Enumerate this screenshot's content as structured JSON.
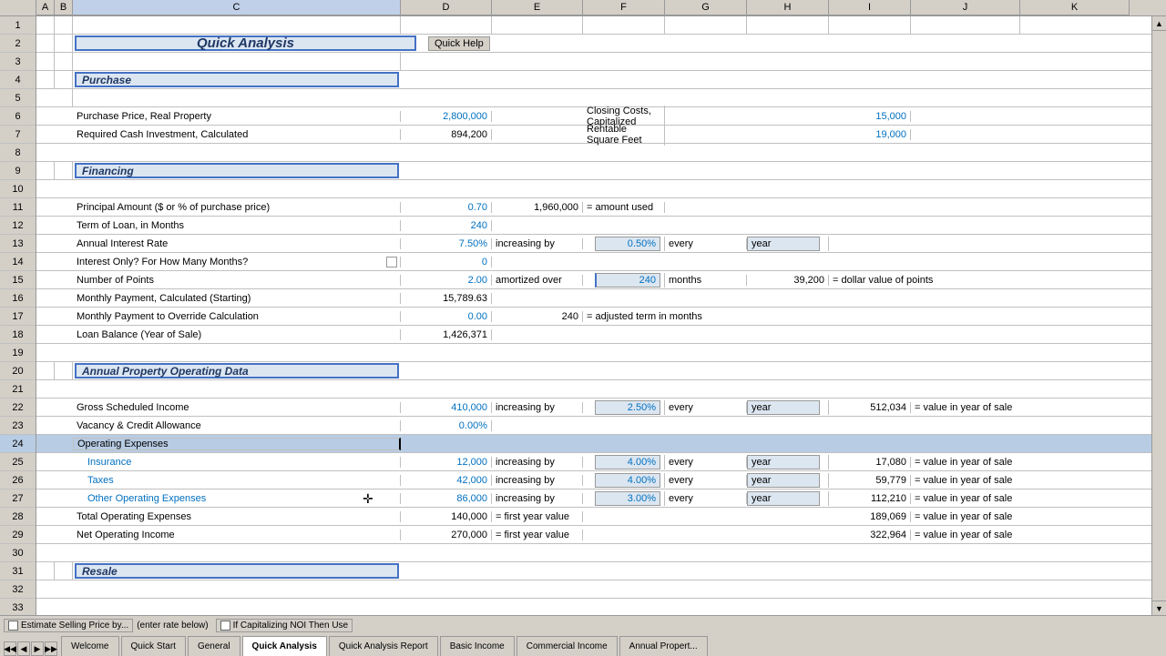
{
  "title": "Quick Analysis",
  "quickHelp": "Quick Help",
  "columns": [
    "A",
    "B",
    "C",
    "D",
    "E",
    "F",
    "G",
    "H",
    "I",
    "J",
    "K"
  ],
  "rows": [
    1,
    2,
    3,
    4,
    5,
    6,
    7,
    8,
    9,
    10,
    11,
    12,
    13,
    14,
    15,
    16,
    17,
    18,
    19,
    20,
    21,
    22,
    23,
    24,
    25,
    26,
    27,
    28,
    29,
    30,
    31,
    32,
    33
  ],
  "sections": {
    "purchase": "Purchase",
    "financing": "Financing",
    "annualPropertyOperatingData": "Annual Property Operating Data",
    "resale": "Resale"
  },
  "fields": {
    "purchasePrice": "Purchase Price, Real Property",
    "purchasePriceValue": "2,800,000",
    "closingCosts": "Closing Costs, Capitalized",
    "closingCostsValue": "15,000",
    "requiredCash": "Required Cash Investment, Calculated",
    "requiredCashValue": "894,200",
    "rentableSquareFeet": "Rentable Square Feet",
    "rentableSquareFeetValue": "19,000",
    "principalAmount": "Principal Amount ($ or % of purchase price)",
    "principalPct": "0.70",
    "principalAmt": "1,960,000",
    "amountUsed": "= amount used",
    "termOfLoan": "Term of Loan, in Months",
    "termValue": "240",
    "annualInterestRate": "Annual Interest Rate",
    "annualInterestRateValue": "7.50%",
    "increasingBy": "increasing by",
    "interestRateIncrement": "0.50%",
    "every": "every",
    "year": "year",
    "interestOnly": "Interest Only?  For How Many Months?",
    "interestOnlyValue": "0",
    "numberOfPoints": "Number of Points",
    "pointsValue": "2.00",
    "amortizedOver": "amortized over",
    "pointsMonths": "240",
    "months": "months",
    "dollarValuePoints": "39,200",
    "dollarValueLabel": "= dollar value of points",
    "monthlyPayment": "Monthly Payment, Calculated (Starting)",
    "monthlyPaymentValue": "15,789.63",
    "monthlyPaymentOverride": "Monthly Payment to Override Calculation",
    "monthlyPaymentOverrideValue": "0.00",
    "adjustedTerm": "240",
    "adjustedTermLabel": "= adjusted term in months",
    "loanBalance": "Loan Balance (Year of Sale)",
    "loanBalanceValue": "1,426,371",
    "grossScheduledIncome": "Gross Scheduled Income",
    "grossValue": "410,000",
    "gsiIncBy": "increasing by",
    "gsiRate": "2.50%",
    "gsiEvery": "every",
    "gsiYear": "year",
    "gsiYearSale": "512,034",
    "gsiYearSaleLabel": "= value in year of sale",
    "vacancyCredit": "Vacancy & Credit Allowance",
    "vacancyValue": "0.00%",
    "operatingExpenses": "Operating Expenses",
    "insurance": "Insurance",
    "insuranceValue": "12,000",
    "insuranceIncBy": "increasing by",
    "insuranceRate": "4.00%",
    "insuranceEvery": "every",
    "insuranceYear": "year",
    "insuranceYearSale": "17,080",
    "insuranceYearSaleLabel": "= value in year of sale",
    "taxes": "Taxes",
    "taxesValue": "42,000",
    "taxesIncBy": "increasing by",
    "taxesRate": "4.00%",
    "taxesEvery": "every",
    "taxesYear": "year",
    "taxesYearSale": "59,779",
    "taxesYearSaleLabel": "= value in year of sale",
    "otherOpEx": "Other Operating Expenses",
    "otherValue": "86,000",
    "otherIncBy": "increasing by",
    "otherRate": "3.00%",
    "otherEvery": "every",
    "otherYear": "year",
    "otherYearSale": "112,210",
    "otherYearSaleLabel": "= value in year of sale",
    "totalOpEx": "Total Operating Expenses",
    "totalOpExValue": "140,000",
    "totalOpExLabel": "= first year value",
    "totalOpExYearSale": "189,069",
    "totalOpExYearSaleLabel": "= value in year of sale",
    "netOpIncome": "Net Operating Income",
    "noi": "270,000",
    "noiLabel": "= first year value",
    "noiYearSale": "322,964",
    "noiYearSaleLabel": "= value in year of sale"
  },
  "statusBar": {
    "estimate": "Estimate  Selling Price by...",
    "enterRate": "(enter rate below)",
    "capitalizing": "If Capitalizing NOI Then Use"
  },
  "tabs": [
    {
      "label": "Welcome",
      "active": false
    },
    {
      "label": "Quick Start",
      "active": false
    },
    {
      "label": "General",
      "active": false
    },
    {
      "label": "Quick Analysis",
      "active": true
    },
    {
      "label": "Quick Analysis Report",
      "active": false
    },
    {
      "label": "Basic Income",
      "active": false
    },
    {
      "label": "Commercial Income",
      "active": false
    },
    {
      "label": "Annual Propert...",
      "active": false
    }
  ],
  "colors": {
    "sectionHeader": "#dce6f1",
    "border": "#4472c4",
    "blueText": "#0070c0",
    "selectedRow": "#b8cce4"
  }
}
